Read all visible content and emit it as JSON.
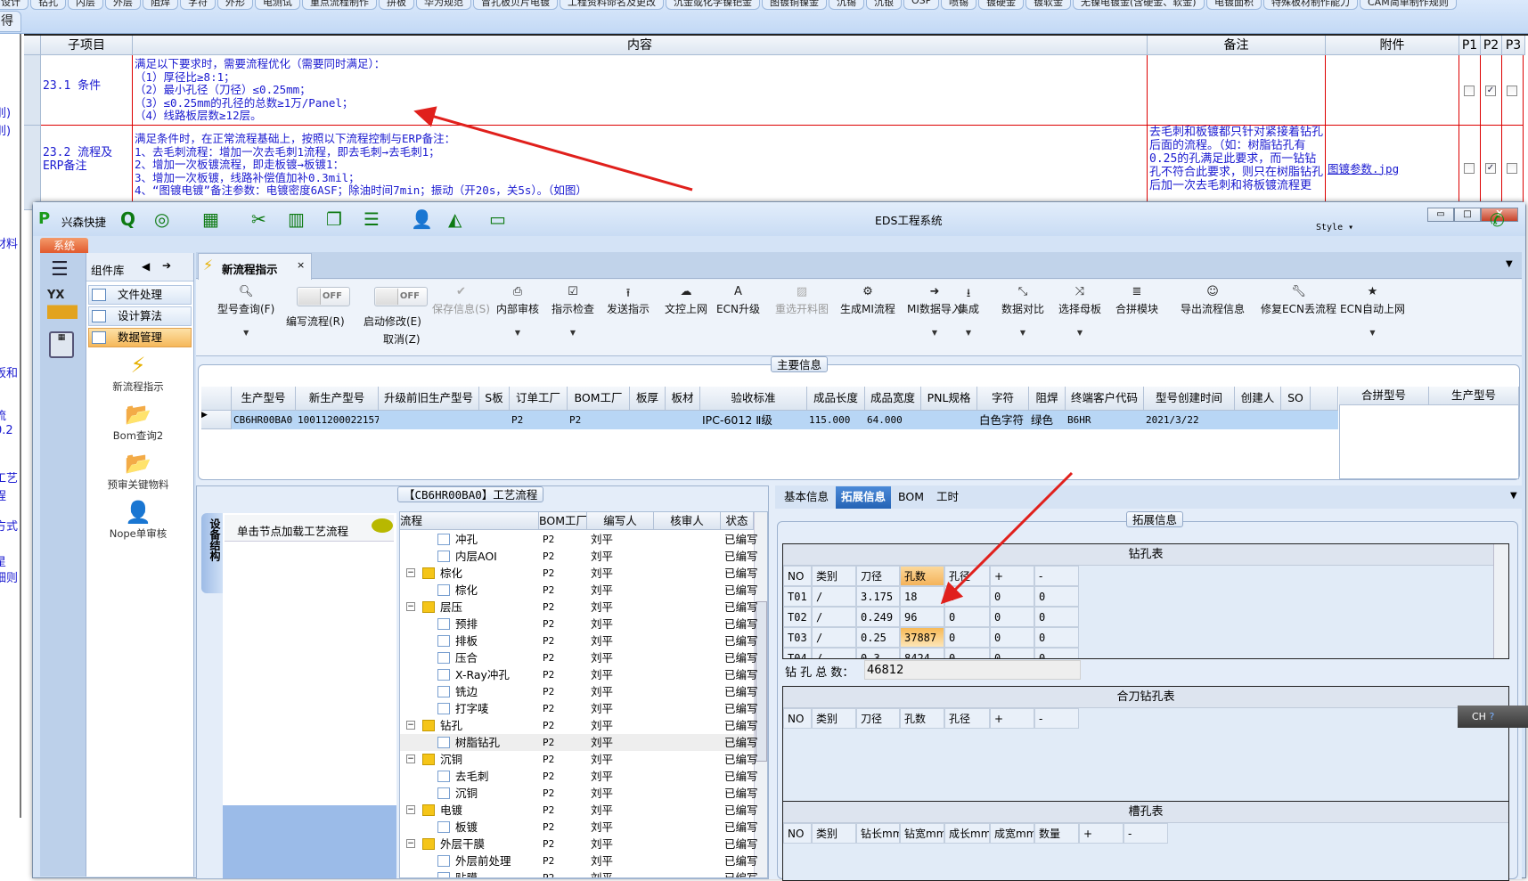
{
  "top_tabs": [
    "设计",
    "钻孔",
    "内层",
    "外层",
    "阻焊",
    "字符",
    "外形",
    "电测试",
    "重点流程制作",
    "拼板",
    "华为规范",
    "冒孔板贝片电镀",
    "工程资料命名及更改",
    "沉金或化学镍钯金",
    "图镀铜镍金",
    "沉锡",
    "沉银",
    "OSP",
    "喷锡",
    "镀硬金",
    "镀软金",
    "无镍电镀金(含硬金、软金)",
    "电镀面积",
    "特殊板材制作能力",
    "CAM简单制作规则"
  ],
  "top_tabs_row2": [
    "得"
  ],
  "left_fragments": [
    "刖)",
    "刖)",
    "材料",
    "板和",
    "流",
    "0.2",
    "工艺",
    "程",
    "方式",
    "星",
    "细则"
  ],
  "rule_table": {
    "headers": {
      "sub": "子项目",
      "content": "内容",
      "note": "备注",
      "attach": "附件",
      "p1": "P1",
      "p2": "P2",
      "p3": "P3"
    },
    "rows": [
      {
        "sub": "23.1 条件",
        "content": "满足以下要求时，需要流程优化（需要同时满足）：\n（1）厚径比≥8:1；\n（2）最小孔径（刀径）≤0.25mm；\n（3）≤0.25mm的孔径的总数≥1万/Panel；\n（4）线路板层数≥12层。",
        "note": "",
        "attach": "",
        "p": [
          false,
          true,
          false
        ]
      },
      {
        "sub": "23.2 流程及ERP备注",
        "content": "满足条件时，在正常流程基础上，按照以下流程控制与ERP备注：\n1、去毛刺流程：增加一次去毛刺1流程，即去毛刺→去毛刺1；\n2、增加一次板镀流程，即走板镀→板镀1：\n3、增加一次板镀，线路补偿值加补0.3mil；\n4、“图镀电镀”备注参数：电镀密度6ASF；除油时间7min；振动（开20s，关5s）。（如图）",
        "note": "去毛刺和板镀都只针对紧接着钻孔后面的流程。（如：树脂钻孔有0.25的孔满足此要求，而一钻钻孔不符合此要求，则只在树脂钻孔后加一次去毛刺和将板镀流程更",
        "attach": "图镀参数.jpg",
        "p": [
          false,
          true,
          false
        ]
      }
    ]
  },
  "window": {
    "title": "EDS工程系统",
    "app_name": "兴森快捷",
    "ribbon_tab": "系统",
    "style_label": "Style",
    "ime": "CH"
  },
  "quick_access": [
    "search-icon",
    "lifebuoy-icon",
    "grid-icon",
    "scissors-icon",
    "film-icon",
    "copy-icon",
    "list-icon",
    "user-icon",
    "chart-icon",
    "monitor-icon"
  ],
  "component_library": {
    "title": "组件库",
    "categories": [
      {
        "label": "文件处理"
      },
      {
        "label": "设计算法"
      },
      {
        "label": "数据管理",
        "active": true
      }
    ],
    "items": [
      {
        "label": "新流程指示",
        "icon": "lightning-icon"
      },
      {
        "label": "Bom查询2",
        "icon": "folder-icon"
      },
      {
        "label": "预审关键物料",
        "icon": "folder-icon"
      },
      {
        "label": "Nope单审核",
        "icon": "user-icon"
      }
    ]
  },
  "doc_tab": {
    "label": "新流程指示"
  },
  "toolbar": [
    {
      "label": "型号查询(F)",
      "icon": "search-icon",
      "dropdown": true
    },
    {
      "label": "编写流程(R)",
      "toggle": "OFF"
    },
    {
      "label": "启动修改(E)",
      "label2": "取消(Z)",
      "toggle": "OFF"
    },
    {
      "label": "保存信息(S)",
      "icon": "check-icon",
      "disabled": true
    },
    {
      "label": "内部审核",
      "icon": "print-icon",
      "dropdown": true
    },
    {
      "label": "指示检查",
      "icon": "checkbox-icon",
      "dropdown": true
    },
    {
      "label": "发送指示",
      "icon": "upload-icon"
    },
    {
      "label": "文控上网",
      "icon": "cloud-upload-icon"
    },
    {
      "label": "ECN升级",
      "icon": "font-icon"
    },
    {
      "label": "重选开料图",
      "icon": "image-icon",
      "disabled": true
    },
    {
      "label": "生成MI流程",
      "icon": "gears-icon"
    },
    {
      "label": "MI数据导入",
      "icon": "sign-in-icon",
      "dropdown": true
    },
    {
      "label": "集成",
      "icon": "download-icon",
      "dropdown": true
    },
    {
      "label": "数据对比",
      "icon": "compress-icon",
      "dropdown": true
    },
    {
      "label": "选择母板",
      "icon": "shuffle-icon",
      "dropdown": true
    },
    {
      "label": "合拼模块",
      "icon": "list-ol-icon"
    },
    {
      "label": "导出流程信息",
      "icon": "smile-icon"
    },
    {
      "label": "修复ECN丢流程",
      "icon": "wrench-icon"
    },
    {
      "label": "ECN自动上网",
      "icon": "star-icon",
      "dropdown": true
    }
  ],
  "main_info": {
    "title": "主要信息",
    "columns": [
      "生产型号",
      "新生产型号",
      "升级前旧生产型号",
      "S板",
      "订单工厂",
      "BOM工厂",
      "板厚",
      "板材",
      "验收标准",
      "成品长度",
      "成品宽度",
      "PNL规格",
      "字符",
      "阻焊",
      "终端客户代码",
      "型号创建时间",
      "创建人",
      "SO"
    ],
    "rows": [
      [
        "CB6HR00BA0",
        "10011200022157",
        "",
        "",
        "P2",
        "P2",
        "",
        "",
        "IPC-6012 Ⅱ级",
        "115.000",
        "64.000",
        "",
        "白色字符",
        "绿色",
        "B6HR",
        "2021/3/22",
        "",
        ""
      ]
    ],
    "merge_columns": [
      "合拼型号",
      "生产型号"
    ]
  },
  "process": {
    "title": "【CB6HR00BA0】工艺流程",
    "side_tab": "设备结构",
    "hint": "单击节点加载工艺流程",
    "columns": [
      "流程",
      "BOM工厂",
      "编写人",
      "核审人",
      "状态"
    ],
    "rows": [
      {
        "name": "冲孔",
        "level": 2,
        "factory": "P2",
        "writer": "刘平",
        "reviewer": "",
        "status": "已编写"
      },
      {
        "name": "内层AOI",
        "level": 2,
        "factory": "P2",
        "writer": "刘平",
        "reviewer": "",
        "status": "已编写"
      },
      {
        "name": "棕化",
        "level": 1,
        "factory": "P2",
        "writer": "刘平",
        "reviewer": "",
        "status": "已编写"
      },
      {
        "name": "棕化",
        "level": 2,
        "factory": "P2",
        "writer": "刘平",
        "reviewer": "",
        "status": "已编写"
      },
      {
        "name": "层压",
        "level": 1,
        "factory": "P2",
        "writer": "刘平",
        "reviewer": "",
        "status": "已编写"
      },
      {
        "name": "预排",
        "level": 2,
        "factory": "P2",
        "writer": "刘平",
        "reviewer": "",
        "status": "已编写"
      },
      {
        "name": "排板",
        "level": 2,
        "factory": "P2",
        "writer": "刘平",
        "reviewer": "",
        "status": "已编写"
      },
      {
        "name": "压合",
        "level": 2,
        "factory": "P2",
        "writer": "刘平",
        "reviewer": "",
        "status": "已编写"
      },
      {
        "name": "X-Ray冲孔",
        "level": 2,
        "factory": "P2",
        "writer": "刘平",
        "reviewer": "",
        "status": "已编写"
      },
      {
        "name": "铣边",
        "level": 2,
        "factory": "P2",
        "writer": "刘平",
        "reviewer": "",
        "status": "已编写"
      },
      {
        "name": "打字唛",
        "level": 2,
        "factory": "P2",
        "writer": "刘平",
        "reviewer": "",
        "status": "已编写"
      },
      {
        "name": "钻孔",
        "level": 1,
        "factory": "P2",
        "writer": "刘平",
        "reviewer": "",
        "status": "已编写"
      },
      {
        "name": "树脂钻孔",
        "level": 2,
        "factory": "P2",
        "writer": "刘平",
        "reviewer": "",
        "status": "已编写",
        "selected": true
      },
      {
        "name": "沉铜",
        "level": 1,
        "factory": "P2",
        "writer": "刘平",
        "reviewer": "",
        "status": "已编写"
      },
      {
        "name": "去毛刺",
        "level": 2,
        "factory": "P2",
        "writer": "刘平",
        "reviewer": "",
        "status": "已编写"
      },
      {
        "name": "沉铜",
        "level": 2,
        "factory": "P2",
        "writer": "刘平",
        "reviewer": "",
        "status": "已编写"
      },
      {
        "name": "电镀",
        "level": 1,
        "factory": "P2",
        "writer": "刘平",
        "reviewer": "",
        "status": "已编写"
      },
      {
        "name": "板镀",
        "level": 2,
        "factory": "P2",
        "writer": "刘平",
        "reviewer": "",
        "status": "已编写"
      },
      {
        "name": "外层干膜",
        "level": 1,
        "factory": "P2",
        "writer": "刘平",
        "reviewer": "",
        "status": "已编写"
      },
      {
        "name": "外层前处理",
        "level": 2,
        "factory": "P2",
        "writer": "刘平",
        "reviewer": "",
        "status": "已编写"
      },
      {
        "name": "贴膜",
        "level": 2,
        "factory": "P2",
        "writer": "刘平",
        "reviewer": "",
        "status": "已编写"
      }
    ]
  },
  "detail": {
    "tabs": [
      {
        "label": "基本信息"
      },
      {
        "label": "拓展信息",
        "active": true
      },
      {
        "label": "BOM"
      },
      {
        "label": "工时"
      }
    ],
    "group_title": "拓展信息",
    "drill_table": {
      "title": "钻孔表",
      "columns": [
        "NO",
        "类别",
        "刀径",
        "孔数",
        "孔径",
        "+",
        "-"
      ],
      "rows": [
        [
          "T01",
          "/",
          "3.175",
          "18",
          "0",
          "0",
          "0"
        ],
        [
          "T02",
          "/",
          "0.249",
          "96",
          "0",
          "0",
          "0"
        ],
        [
          "T03",
          "/",
          "0.25",
          "37887",
          "0",
          "0",
          "0"
        ],
        [
          "T04",
          "/",
          "0.3",
          "8424",
          "0",
          "0",
          "0"
        ]
      ],
      "highlight": {
        "row": 2,
        "col": 3
      },
      "total_label": "钻 孔 总 数：",
      "total_value": "46812"
    },
    "combo_table": {
      "title": "合刀钻孔表",
      "columns": [
        "NO",
        "类别",
        "刀径",
        "孔数",
        "孔径",
        "+",
        "-"
      ]
    },
    "slot_table": {
      "title": "槽孔表",
      "columns": [
        "NO",
        "类别",
        "钻长mm",
        "钻宽mm",
        "成长mm",
        "成宽mm",
        "数量",
        "+",
        "-"
      ]
    }
  },
  "colors": {
    "annotation_arrow": "#e0201c",
    "rule_text": "#1a1ad0",
    "highlight": "#f7b955",
    "selection": "#b8d6f5"
  }
}
